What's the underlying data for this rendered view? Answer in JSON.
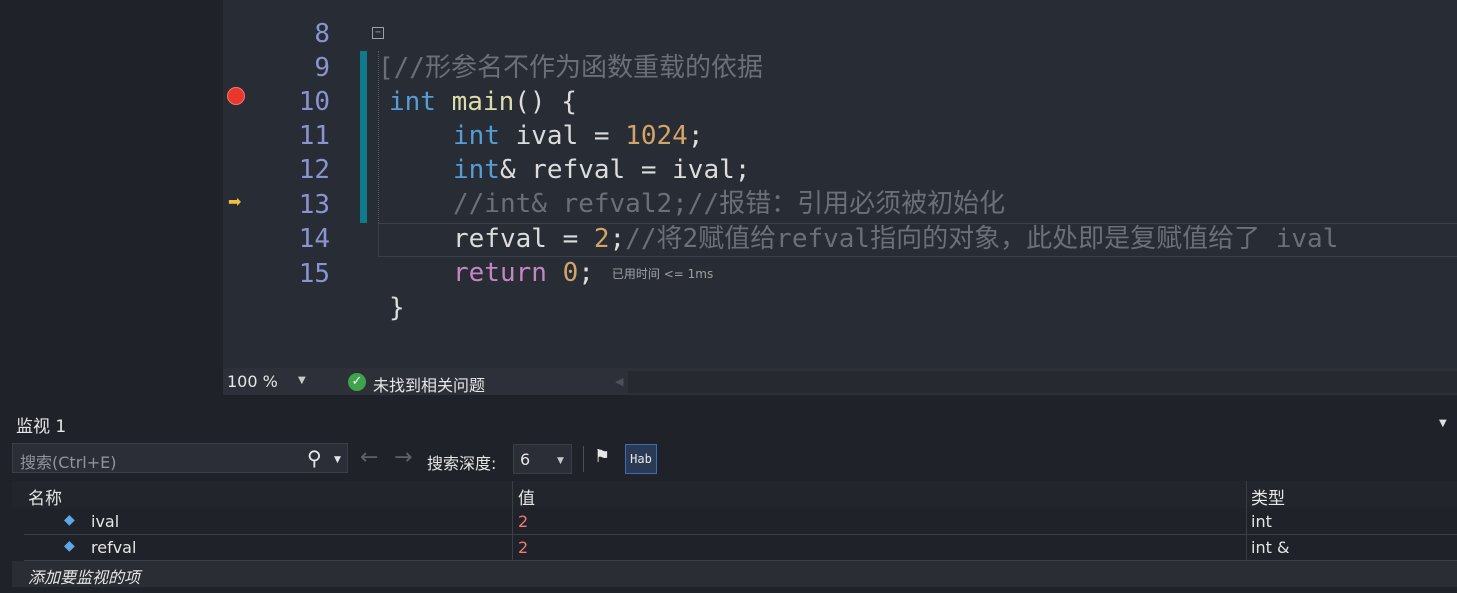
{
  "editor": {
    "lines": [
      {
        "num": "8",
        "text": "[//形参名不作为函数重载的依据"
      },
      {
        "num": "9",
        "kw": "int",
        "rest_fn": "main",
        "rest": "() {"
      },
      {
        "num": "10",
        "kw": "int",
        "ident": " ival = ",
        "num_val": "1024",
        "end": ";"
      },
      {
        "num": "11",
        "kw": "int",
        "ident": "& refval = ival;"
      },
      {
        "num": "12",
        "comment": "//int& refval2;//报错：引用必须被初始化"
      },
      {
        "num": "13",
        "ident": "refval = ",
        "num_val": "2",
        "end": ";",
        "comment": "//将2赋值给refval指向的对象，此处即是复赋值给了 ival"
      },
      {
        "num": "14",
        "kw": "return",
        "ident": " ",
        "num_val": "0",
        "end": ";",
        "elapsed": "已用时间 <= 1ms"
      },
      {
        "num": "15",
        "text": "}"
      }
    ]
  },
  "statusbar": {
    "zoom": "100 %",
    "issues": "未找到相关问题"
  },
  "watch": {
    "title": "监视 1",
    "search_placeholder": "搜索(Ctrl+E)",
    "depth_label": "搜索深度:",
    "depth_value": "6",
    "hex_button": "Hab",
    "columns": {
      "name": "名称",
      "value": "值",
      "type": "类型"
    },
    "rows": [
      {
        "name": "ival",
        "value": "2",
        "type": "int"
      },
      {
        "name": "refval",
        "value": "2",
        "type": "int &"
      }
    ],
    "add_item": "添加要监视的项"
  }
}
